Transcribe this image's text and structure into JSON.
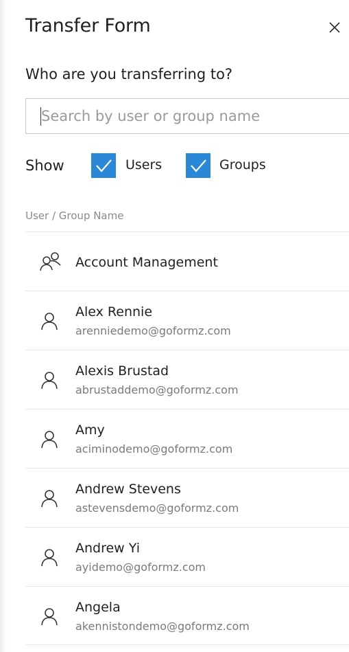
{
  "panel": {
    "title": "Transfer Form",
    "close_icon": "close-icon"
  },
  "form": {
    "prompt": "Who are you transferring to?",
    "search": {
      "value": "",
      "placeholder": "Search by user or group name"
    },
    "show": {
      "label": "Show",
      "users": {
        "label": "Users",
        "checked": true
      },
      "groups": {
        "label": "Groups",
        "checked": true
      }
    },
    "column_header": "User / Group Name"
  },
  "colors": {
    "accent": "#2b88d8",
    "text": "#1f1f1f",
    "muted": "#7a7a7a",
    "divider": "#e5e5e5"
  },
  "entries": [
    {
      "type": "group",
      "icon": "group-icon",
      "name": "Account Management",
      "email": ""
    },
    {
      "type": "user",
      "icon": "user-icon",
      "name": "Alex Rennie",
      "email": "arenniedemo@goformz.com"
    },
    {
      "type": "user",
      "icon": "user-icon",
      "name": "Alexis Brustad",
      "email": "abrustaddemo@goformz.com"
    },
    {
      "type": "user",
      "icon": "user-icon",
      "name": "Amy",
      "email": "aciminodemo@goformz.com"
    },
    {
      "type": "user",
      "icon": "user-icon",
      "name": "Andrew Stevens",
      "email": "astevensdemo@goformz.com"
    },
    {
      "type": "user",
      "icon": "user-icon",
      "name": "Andrew Yi",
      "email": "ayidemo@goformz.com"
    },
    {
      "type": "user",
      "icon": "user-icon",
      "name": "Angela",
      "email": "akennistondemo@goformz.com"
    }
  ]
}
